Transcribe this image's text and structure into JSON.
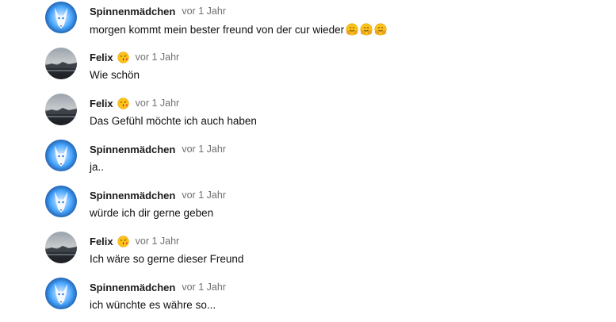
{
  "messages": [
    {
      "author": "Spinnenmädchen",
      "avatar": "white-wolf-avatar",
      "badge": null,
      "time": "vor 1 Jahr",
      "text": "morgen kommt mein bester freund von der cur wieder",
      "trailing_emojis": [
        "hugging-face-emoji",
        "hugging-face-emoji",
        "hugging-face-emoji"
      ]
    },
    {
      "author": "Felix",
      "avatar": "landscape-avatar",
      "badge": "kissing-face-emoji",
      "time": "vor 1 Jahr",
      "text": "Wie schön",
      "trailing_emojis": []
    },
    {
      "author": "Felix",
      "avatar": "landscape-avatar",
      "badge": "kissing-face-emoji",
      "time": "vor 1 Jahr",
      "text": "Das Gefühl möchte ich auch haben",
      "trailing_emojis": []
    },
    {
      "author": "Spinnenmädchen",
      "avatar": "white-wolf-avatar",
      "badge": null,
      "time": "vor 1 Jahr",
      "text": "ja..",
      "trailing_emojis": []
    },
    {
      "author": "Spinnenmädchen",
      "avatar": "white-wolf-avatar",
      "badge": null,
      "time": "vor 1 Jahr",
      "text": "würde ich dir gerne geben",
      "trailing_emojis": []
    },
    {
      "author": "Felix",
      "avatar": "landscape-avatar",
      "badge": "kissing-face-emoji",
      "time": "vor 1 Jahr",
      "text": "Ich wäre so gerne dieser Freund",
      "trailing_emojis": []
    },
    {
      "author": "Spinnenmädchen",
      "avatar": "white-wolf-avatar",
      "badge": null,
      "time": "vor 1 Jahr",
      "text": "ich wünchte es währe so...",
      "trailing_emojis": []
    }
  ]
}
